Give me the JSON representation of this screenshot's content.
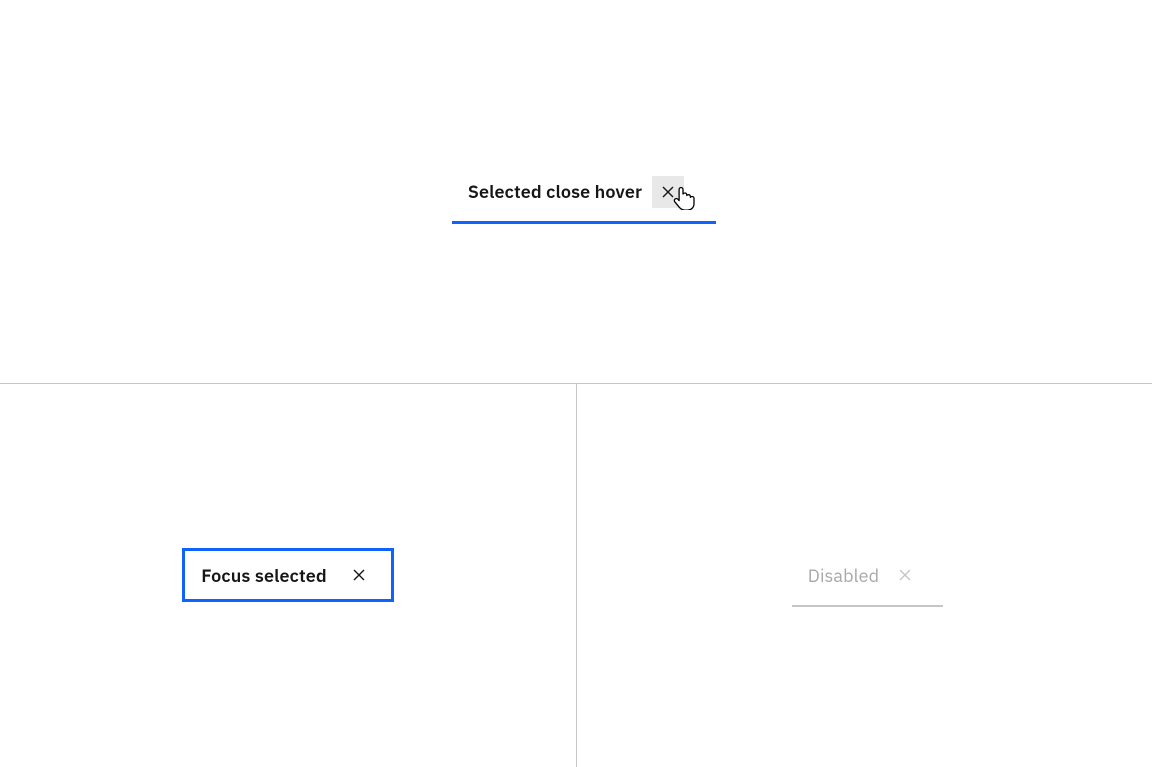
{
  "colors": {
    "accent": "#0f62fe",
    "hover_bg": "#e8e8e8",
    "divider": "#c6c6c6",
    "disabled_text": "#a8a8a8",
    "text": "#161616"
  },
  "states": {
    "selected_close_hover": {
      "label": "Selected close hover"
    },
    "focus_selected": {
      "label": "Focus selected"
    },
    "disabled": {
      "label": "Disabled"
    }
  }
}
